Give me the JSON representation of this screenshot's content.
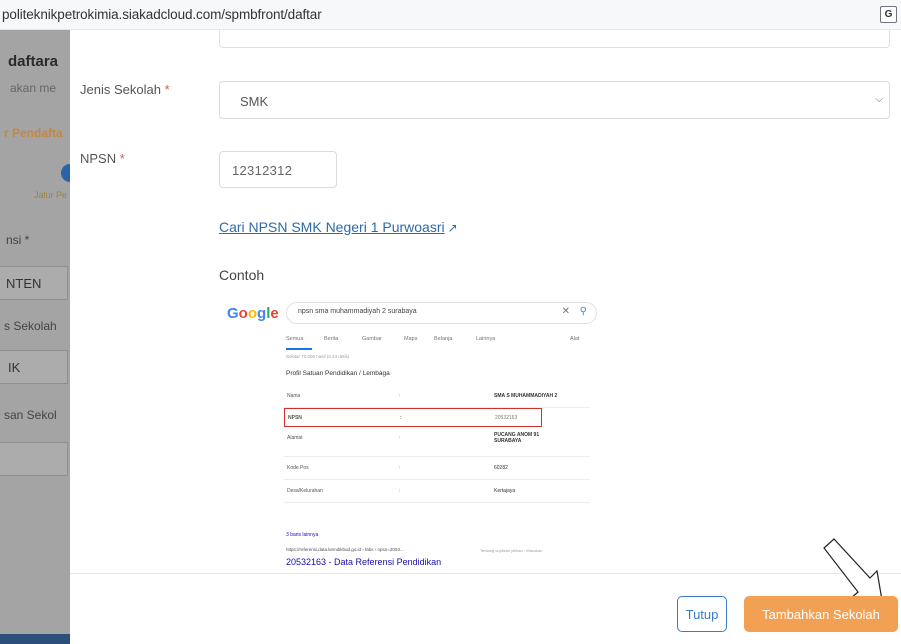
{
  "browser": {
    "url": "politeknikpetrokimia.siakadcloud.com/spmbfront/daftar",
    "translate_icon": "translate-icon"
  },
  "background": {
    "title": "daftara",
    "subtitle": "akan me",
    "section": "r Pendafta",
    "step_label": "Jalur Pe",
    "province_label": "nsi *",
    "regency_value": "NTEN",
    "school_type_label": "s Sekolah",
    "school_type_value": "IK",
    "origin_label": "san Sekol"
  },
  "modal": {
    "jenis_label": "Jenis Sekolah",
    "jenis_value": "SMK",
    "npsn_label": "NPSN",
    "npsn_value": "12312312",
    "npsn_link": "Cari NPSN SMK Negeri 1 Purwoasri",
    "contoh_label": "Contoh",
    "required_mark": "*",
    "example": {
      "google_logo": [
        "G",
        "o",
        "o",
        "g",
        "l",
        "e"
      ],
      "query": "npsn sma muhammadiyah 2 surabaya",
      "tabs": [
        "Semua",
        "Berita",
        "Gambar",
        "Maps",
        "Belanja",
        "Lainnya",
        "Alat"
      ],
      "stats": "Sekitar 70.000 hasil (0,43 detik)",
      "profile_title": "Profil Satuan Pendidikan / Lembaga",
      "rows": [
        {
          "k": "Nama",
          "sep": ":",
          "v": "SMA S MUHAMMADIYAH 2"
        },
        {
          "k": "NPSN",
          "sep": ":",
          "v": "20532163"
        },
        {
          "k": "Alamat",
          "sep": ":",
          "v": "PUCANG ANOM 91 SURABAYA"
        },
        {
          "k": "Kode Pos",
          "sep": ":",
          "v": "60282"
        },
        {
          "k": "Desa/Kelurahan",
          "sep": ":",
          "v": "Kertajaya"
        }
      ],
      "more": "3 baris lainnya",
      "result_url": "https://referensi.data.kemdikbud.go.id › tabs › npsn=2053...",
      "result_title": "20532163 - Data Referensi Pendidikan",
      "footer": "Tentang cuplikan pilihan  ·  Masukan"
    }
  },
  "buttons": {
    "tutup": "Tutup",
    "tambah": "Tambahkan Sekolah"
  },
  "colors": {
    "link": "#2c6ba8",
    "primary_outline": "#3a7bc8",
    "accent": "#f2a154",
    "highlight": "#d32f2f"
  }
}
